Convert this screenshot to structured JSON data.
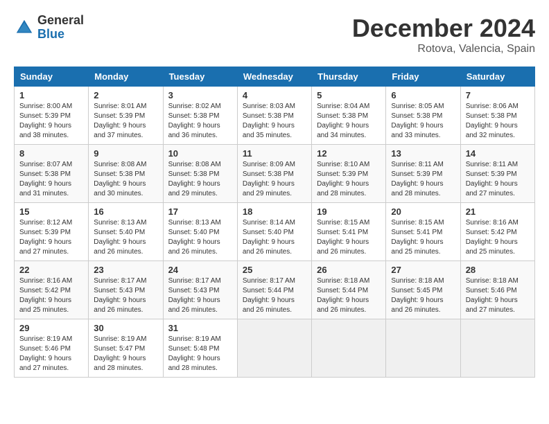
{
  "header": {
    "logo_general": "General",
    "logo_blue": "Blue",
    "title": "December 2024",
    "location": "Rotova, Valencia, Spain"
  },
  "days_of_week": [
    "Sunday",
    "Monday",
    "Tuesday",
    "Wednesday",
    "Thursday",
    "Friday",
    "Saturday"
  ],
  "weeks": [
    [
      {
        "day": "1",
        "sunrise": "8:00 AM",
        "sunset": "5:39 PM",
        "daylight": "9 hours and 38 minutes."
      },
      {
        "day": "2",
        "sunrise": "8:01 AM",
        "sunset": "5:39 PM",
        "daylight": "9 hours and 37 minutes."
      },
      {
        "day": "3",
        "sunrise": "8:02 AM",
        "sunset": "5:38 PM",
        "daylight": "9 hours and 36 minutes."
      },
      {
        "day": "4",
        "sunrise": "8:03 AM",
        "sunset": "5:38 PM",
        "daylight": "9 hours and 35 minutes."
      },
      {
        "day": "5",
        "sunrise": "8:04 AM",
        "sunset": "5:38 PM",
        "daylight": "9 hours and 34 minutes."
      },
      {
        "day": "6",
        "sunrise": "8:05 AM",
        "sunset": "5:38 PM",
        "daylight": "9 hours and 33 minutes."
      },
      {
        "day": "7",
        "sunrise": "8:06 AM",
        "sunset": "5:38 PM",
        "daylight": "9 hours and 32 minutes."
      }
    ],
    [
      {
        "day": "8",
        "sunrise": "8:07 AM",
        "sunset": "5:38 PM",
        "daylight": "9 hours and 31 minutes."
      },
      {
        "day": "9",
        "sunrise": "8:08 AM",
        "sunset": "5:38 PM",
        "daylight": "9 hours and 30 minutes."
      },
      {
        "day": "10",
        "sunrise": "8:08 AM",
        "sunset": "5:38 PM",
        "daylight": "9 hours and 29 minutes."
      },
      {
        "day": "11",
        "sunrise": "8:09 AM",
        "sunset": "5:38 PM",
        "daylight": "9 hours and 29 minutes."
      },
      {
        "day": "12",
        "sunrise": "8:10 AM",
        "sunset": "5:39 PM",
        "daylight": "9 hours and 28 minutes."
      },
      {
        "day": "13",
        "sunrise": "8:11 AM",
        "sunset": "5:39 PM",
        "daylight": "9 hours and 28 minutes."
      },
      {
        "day": "14",
        "sunrise": "8:11 AM",
        "sunset": "5:39 PM",
        "daylight": "9 hours and 27 minutes."
      }
    ],
    [
      {
        "day": "15",
        "sunrise": "8:12 AM",
        "sunset": "5:39 PM",
        "daylight": "9 hours and 27 minutes."
      },
      {
        "day": "16",
        "sunrise": "8:13 AM",
        "sunset": "5:40 PM",
        "daylight": "9 hours and 26 minutes."
      },
      {
        "day": "17",
        "sunrise": "8:13 AM",
        "sunset": "5:40 PM",
        "daylight": "9 hours and 26 minutes."
      },
      {
        "day": "18",
        "sunrise": "8:14 AM",
        "sunset": "5:40 PM",
        "daylight": "9 hours and 26 minutes."
      },
      {
        "day": "19",
        "sunrise": "8:15 AM",
        "sunset": "5:41 PM",
        "daylight": "9 hours and 26 minutes."
      },
      {
        "day": "20",
        "sunrise": "8:15 AM",
        "sunset": "5:41 PM",
        "daylight": "9 hours and 25 minutes."
      },
      {
        "day": "21",
        "sunrise": "8:16 AM",
        "sunset": "5:42 PM",
        "daylight": "9 hours and 25 minutes."
      }
    ],
    [
      {
        "day": "22",
        "sunrise": "8:16 AM",
        "sunset": "5:42 PM",
        "daylight": "9 hours and 25 minutes."
      },
      {
        "day": "23",
        "sunrise": "8:17 AM",
        "sunset": "5:43 PM",
        "daylight": "9 hours and 26 minutes."
      },
      {
        "day": "24",
        "sunrise": "8:17 AM",
        "sunset": "5:43 PM",
        "daylight": "9 hours and 26 minutes."
      },
      {
        "day": "25",
        "sunrise": "8:17 AM",
        "sunset": "5:44 PM",
        "daylight": "9 hours and 26 minutes."
      },
      {
        "day": "26",
        "sunrise": "8:18 AM",
        "sunset": "5:44 PM",
        "daylight": "9 hours and 26 minutes."
      },
      {
        "day": "27",
        "sunrise": "8:18 AM",
        "sunset": "5:45 PM",
        "daylight": "9 hours and 26 minutes."
      },
      {
        "day": "28",
        "sunrise": "8:18 AM",
        "sunset": "5:46 PM",
        "daylight": "9 hours and 27 minutes."
      }
    ],
    [
      {
        "day": "29",
        "sunrise": "8:19 AM",
        "sunset": "5:46 PM",
        "daylight": "9 hours and 27 minutes."
      },
      {
        "day": "30",
        "sunrise": "8:19 AM",
        "sunset": "5:47 PM",
        "daylight": "9 hours and 28 minutes."
      },
      {
        "day": "31",
        "sunrise": "8:19 AM",
        "sunset": "5:48 PM",
        "daylight": "9 hours and 28 minutes."
      },
      null,
      null,
      null,
      null
    ]
  ]
}
